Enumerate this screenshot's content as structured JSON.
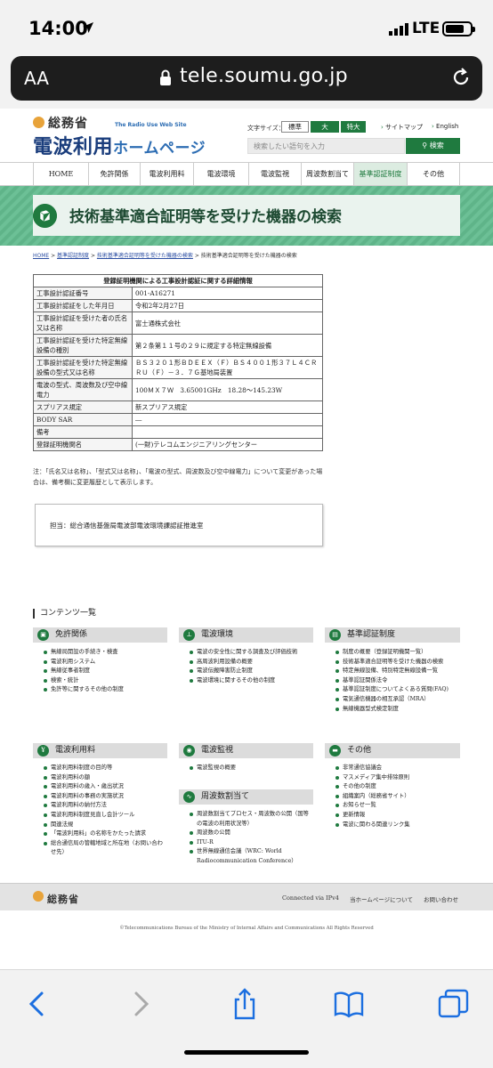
{
  "status_bar": {
    "time": "14:00",
    "network": "LTE"
  },
  "browser": {
    "text_size_label": "AA",
    "url": "tele.soumu.go.jp"
  },
  "header": {
    "ministry": "総務省",
    "tagline": "The Radio Use Web Site",
    "site_name": "電波利用",
    "site_name_suffix": "ホームページ",
    "font_size_label": "文字サイズ：",
    "font_sizes": [
      "標準",
      "大",
      "特大"
    ],
    "sitemap": "サイトマップ",
    "english": "English",
    "search_placeholder": "検索したい語句を入力",
    "search_button": "検索"
  },
  "nav": [
    "HOME",
    "免許関係",
    "電波利用料",
    "電波環境",
    "電波監視",
    "周波数割当て",
    "基準認証制度",
    "その他"
  ],
  "page_title": "技術基準適合証明等を受けた機器の検索",
  "breadcrumb": [
    "HOME",
    "基準認証制度",
    "技術基準適合証明等を受けた機器の検索",
    "技術基準適合証明等を受けた機器の検索"
  ],
  "detail_table": {
    "caption": "登録証明機関による工事設計認証に関する詳細情報",
    "rows": [
      {
        "label": "工事設計認証番号",
        "value": "001-A16271"
      },
      {
        "label": "工事設計認証をした年月日",
        "value": "令和2年2月27日"
      },
      {
        "label": "工事設計認証を受けた者の氏名又は名称",
        "value": "富士通株式会社"
      },
      {
        "label": "工事設計認証を受けた特定無線設備の種別",
        "value": "第２条第１１号の２９に規定する特定無線設備"
      },
      {
        "label": "工事設計認証を受けた特定無線設備の型式又は名称",
        "value": "ＢＳ３２０１形ＢＤＥＥＸ（Ｆ）ＢＳ４００１形３７Ｌ４ＣＲＲＵ（Ｆ）－３．７Ｇ基地局装置"
      },
      {
        "label": "電波の型式、周波数及び空中線電力",
        "value": "100ＭＸ７Ｗ　3.65001GHz　18.28～145.23W"
      },
      {
        "label": "スプリアス規定",
        "value": "新スプリアス規定"
      },
      {
        "label": "BODY SAR",
        "value": "―"
      },
      {
        "label": "備考",
        "value": ""
      },
      {
        "label": "登録証明機関名",
        "value": "(一財)テレコムエンジニアリングセンター"
      }
    ]
  },
  "note": "注：「氏名又は名称」、「型式又は名称」、「電波の型式、周波数及び空中線電力」について変更があった場合は、備考欄に変更履歴として表示します。",
  "contact": "担当：総合通信基盤局電波部電波環境課認証推進室",
  "contents": {
    "title": "コンテンツ一覧",
    "categories": [
      {
        "name": "免許関係",
        "items": [
          "無線局開設の手続き・検査",
          "電波利用システム",
          "無線従事者制度",
          "検索・統計",
          "免許等に関するその他の制度"
        ]
      },
      {
        "name": "電波環境",
        "items": [
          "電波の安全性に関する調査及び評価技術",
          "高周波利用設備の概要",
          "電波伝搬障害防止制度",
          "電波環境に関するその他の制度"
        ]
      },
      {
        "name": "基準認証制度",
        "items": [
          "制度の概要（登録証明機関一覧）",
          "技術基準適合証明等を受けた機器の検索",
          "特定無線設備、特別特定無線設備一覧",
          "基準認証関係法令",
          "基準認証制度についてよくある質問(FAQ)",
          "電気通信機器の相互承認（MRA）",
          "無線機器型式検定制度"
        ]
      },
      {
        "name": "電波利用料",
        "items": [
          "電波利用料制度の目的等",
          "電波利用料の額",
          "電波利用料の歳入・歳出状況",
          "電波利用料の事務の実施状況",
          "電波利用料の納付方法",
          "電波利用料制度見直し会計ツール",
          "関連法規",
          "「電波利用料」の名称をかたった請求",
          "総合通信局の管轄地域と所在地（お問い合わせ先）"
        ]
      },
      {
        "name": "電波監視",
        "items": [
          "電波監視の概要"
        ]
      },
      {
        "name": "周波数割当て",
        "items": [
          "周波数割当てプロセス・周波数の公開（国等の電波の利用状況等）",
          "周波数の公開",
          "ITU-R",
          "世界無線通信会議（WRC: World Radiocommunication Conference）"
        ]
      },
      {
        "name": "その他",
        "items": [
          "非常通信協議会",
          "マスメディア集中排除原則",
          "その他の制度",
          "組織案内（総務省サイト）",
          "お知らせ一覧",
          "更新情報",
          "電波に関わる関連リンク集"
        ]
      }
    ]
  },
  "footer": {
    "ministry": "総務省",
    "ipv6": "Connected via IPv4",
    "about": "当ホームページについて",
    "contact": "お問い合わせ",
    "copyright": "©Telecommunications Bureau of the Ministry of Internal Affairs and Communications All Rights Reserved"
  },
  "icons": [
    "location-arrow-icon",
    "signal-icon",
    "battery-icon",
    "lock-icon",
    "reload-icon",
    "back-icon",
    "forward-icon",
    "share-icon",
    "bookmarks-icon",
    "tabs-icon"
  ],
  "colors": {
    "brand_green": "#1f7a3f",
    "banner_green": "#5fb489",
    "logo_blue": "#1a3d7c"
  }
}
